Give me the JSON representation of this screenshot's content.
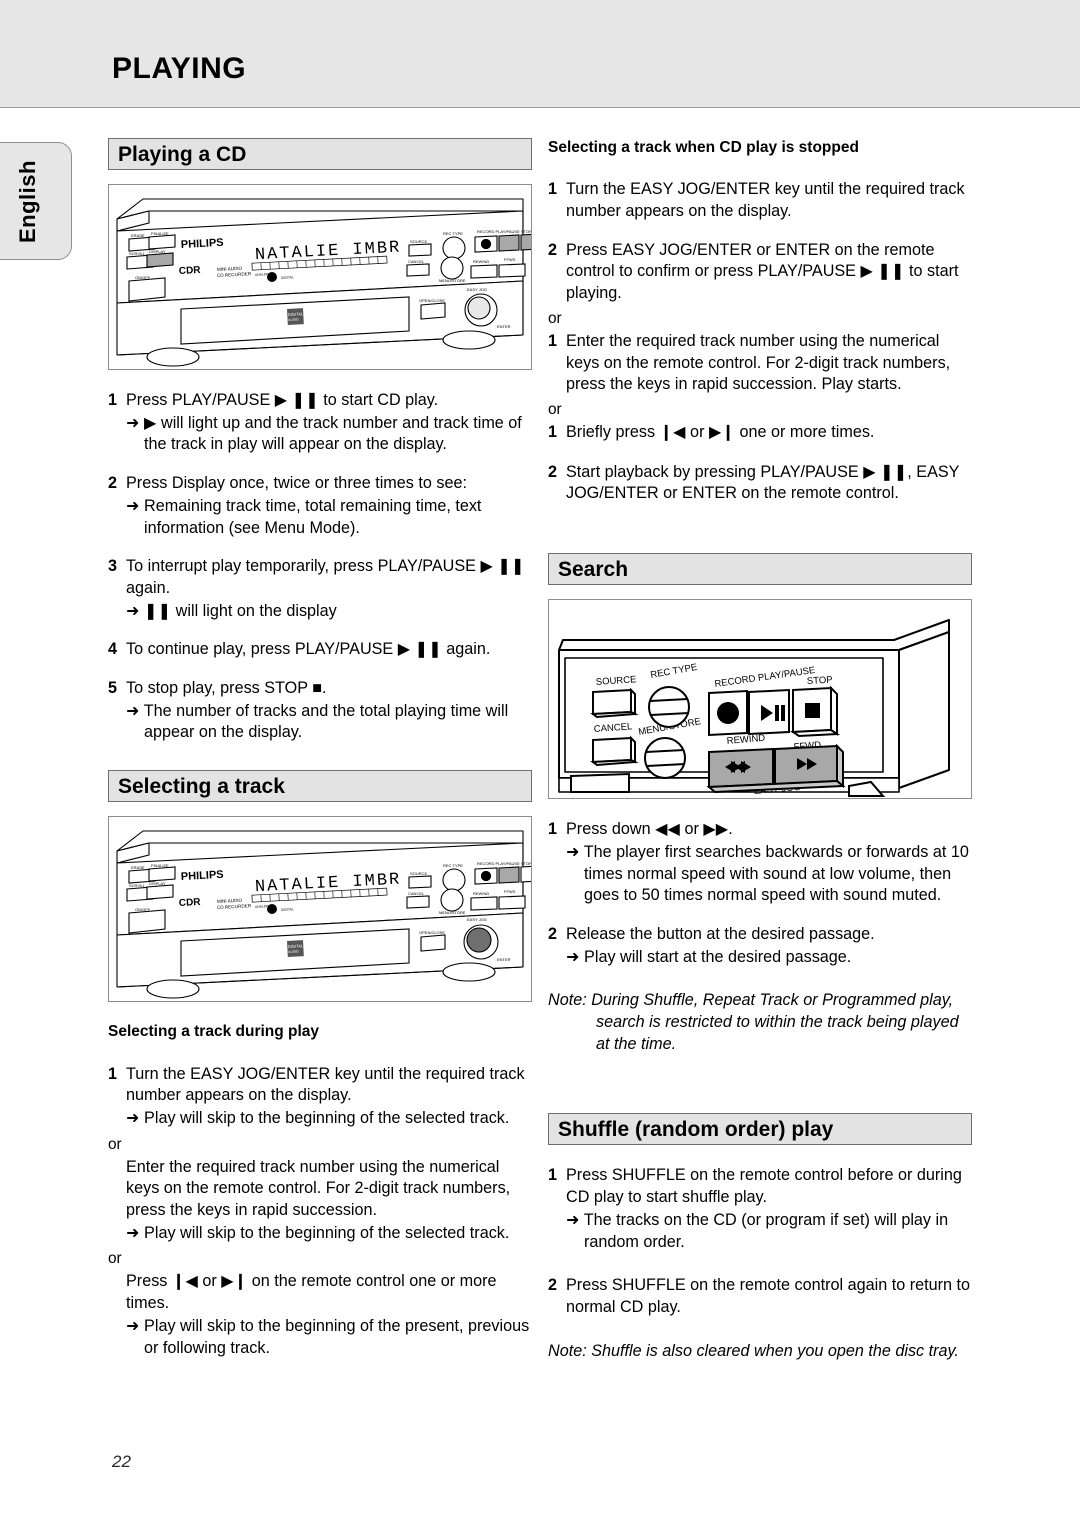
{
  "header": {
    "title": "PLAYING"
  },
  "side_tab": {
    "label": "English"
  },
  "footer": {
    "page_number": "22"
  },
  "left_column": {
    "section_playing_cd": {
      "heading": "Playing a CD",
      "illustration": {
        "name": "philips-cdr-front-panel",
        "brand": "PHILIPS",
        "model_label": "CDR",
        "sub_label_line1": "MINI AUDIO",
        "sub_label_line2": "CD RECORDER",
        "display_text": "NATALIE IMBR",
        "disc_badge": "DIGITAL AUDIO",
        "buttons": [
          "ERASE",
          "FINALIZE",
          "SCROLL",
          "DISPLAY",
          "ON/OFF",
          "SOURCE",
          "REC TYPE",
          "CANCEL",
          "MENU/STORE",
          "RECORD",
          "PLAY/PAUSE",
          "STOP",
          "REWIND",
          "FFWD",
          "OPEN/CLOSE",
          "EASY JOG"
        ],
        "highlighted_button": "DISPLAY"
      },
      "steps": [
        {
          "num": "1",
          "text": "Press PLAY/PAUSE ▶ ❚❚ to start CD play.",
          "arrows": [
            "➜ ▶ will light up and the track number and track time of the track in play will appear on the display."
          ]
        },
        {
          "num": "2",
          "text": "Press Display once, twice or three times to see:",
          "arrows": [
            "➜ Remaining track time, total remaining time, text information (see Menu Mode)."
          ]
        },
        {
          "num": "3",
          "text": "To interrupt play temporarily, press PLAY/PAUSE ▶ ❚❚ again.",
          "arrows": [
            "➜ ❚❚ will light on the display"
          ]
        },
        {
          "num": "4",
          "text": "To continue play, press PLAY/PAUSE ▶ ❚❚ again.",
          "arrows": []
        },
        {
          "num": "5",
          "text": "To stop play, press STOP ■.",
          "arrows": [
            "➜ The number of tracks and the total playing time will appear on the display."
          ]
        }
      ]
    },
    "section_selecting_track": {
      "heading": "Selecting a track",
      "illustration": {
        "name": "philips-cdr-front-panel",
        "brand": "PHILIPS",
        "model_label": "CDR",
        "sub_label_line1": "MINI AUDIO",
        "sub_label_line2": "CD RECORDER",
        "display_text": "NATALIE IMBR",
        "disc_badge": "DIGITAL AUDIO",
        "highlighted_button": "EASY JOG"
      },
      "sub_heading": "Selecting a track during play",
      "steps": [
        {
          "num": "1",
          "text": "Turn the EASY JOG/ENTER key until the required track number appears on  the display.",
          "arrows": [
            "➜ Play will skip to the beginning of the selected track."
          ]
        }
      ],
      "or_1": "or",
      "cont_1": "Enter the required track number using the numerical keys on the remote  control. For 2-digit track numbers, press the keys in rapid succession.",
      "arrow_after_cont_1": "➜ Play will skip to the beginning of the selected track.",
      "or_2": "or",
      "cont_2": "Press ❙◀  or ▶❙ on the remote control one or more times.",
      "arrow_after_cont_2": "➜ Play will skip to the beginning of the present, previous or following track."
    }
  },
  "right_column": {
    "section_track_stopped": {
      "sub_heading": "Selecting a track when CD play is stopped",
      "steps": [
        {
          "num": "1",
          "text": "Turn the EASY JOG/ENTER key until the required track number appears on  the display.",
          "arrows": []
        },
        {
          "num": "2",
          "text": "Press EASY JOG/ENTER or ENTER on the remote control to confirm or press PLAY/PAUSE ▶ ❚❚ to start playing.",
          "arrows": []
        }
      ],
      "or_1": "or",
      "step_alt_1": {
        "num": "1",
        "text": "Enter the required track number using the numerical keys on the remote control. For 2-digit track numbers, press the keys in rapid succession. Play starts."
      },
      "or_2": "or",
      "step_alt_2": {
        "num": "1",
        "text": "Briefly press ❙◀ or ▶❙  one or more times."
      },
      "step_alt_3": {
        "num": "2",
        "text": "Start playback by pressing PLAY/PAUSE ▶ ❚❚, EASY JOG/ENTER or ENTER on the remote control."
      }
    },
    "section_search": {
      "heading": "Search",
      "illustration": {
        "name": "philips-cdr-transport-controls",
        "labels": [
          "SOURCE",
          "REC TYPE",
          "RECORD",
          "PLAY/PAUSE",
          "STOP",
          "CANCEL",
          "MENU/STORE",
          "REWIND",
          "FFWD",
          "EASY JOG"
        ],
        "highlighted_buttons": [
          "REWIND",
          "FFWD"
        ]
      },
      "steps": [
        {
          "num": "1",
          "text": "Press down ◀◀ or ▶▶.",
          "arrows": [
            "➜ The player first searches backwards or forwards at 10 times normal speed  with sound at low volume, then goes to 50 times normal speed with sound muted."
          ]
        },
        {
          "num": "2",
          "text": "Release the button at the desired passage.",
          "arrows": [
            "➜ Play will start at the desired passage."
          ]
        }
      ],
      "note": "Note: During Shuffle, Repeat Track or Programmed play, search is restricted to within the track being played at the time."
    },
    "section_shuffle": {
      "heading": "Shuffle (random order) play",
      "steps": [
        {
          "num": "1",
          "text": "Press SHUFFLE on the remote control before or during CD play to start shuffle play.",
          "arrows": [
            "➜ The tracks on the CD (or program if set) will play in random order."
          ]
        },
        {
          "num": "2",
          "text": "Press SHUFFLE on the remote control again to return to normal CD play.",
          "arrows": []
        }
      ],
      "note": "Note: Shuffle is also cleared when you open the disc tray."
    }
  },
  "colors": {
    "band_gray": "#e6e6e6",
    "bar_gray": "#e3e3e3",
    "border_gray": "#8c8c8c",
    "highlight_gray": "#a8a8a8"
  }
}
